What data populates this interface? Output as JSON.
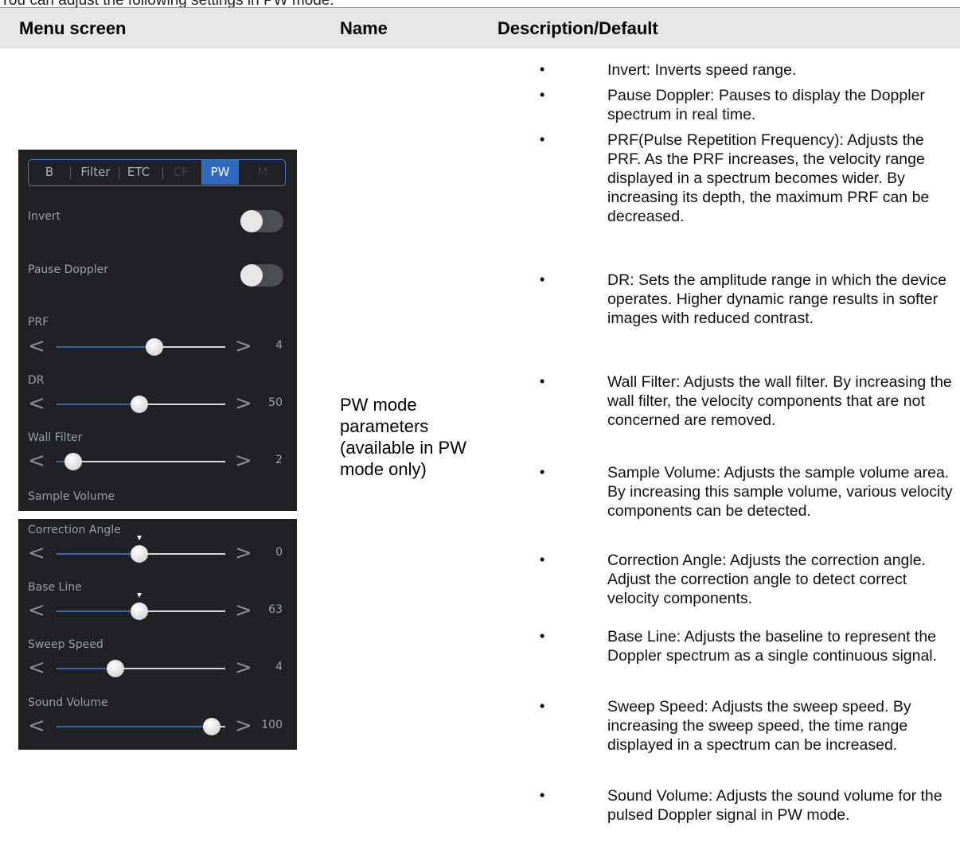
{
  "intro_text": "You can adjust the following settings in PW mode:",
  "table": {
    "headers": [
      "Menu screen",
      "Name",
      "Description/Default"
    ],
    "name": "PW mode parameters (available in PW mode only)"
  },
  "descriptions": [
    "Invert: Inverts speed range.",
    "Pause Doppler: Pauses to display the Doppler spectrum in real time.",
    "PRF(Pulse Repetition Frequency): Adjusts the PRF. As the PRF increases, the velocity range displayed in a spectrum becomes wider. By increasing its depth, the maximum PRF can be decreased.",
    "DR: Sets the amplitude range in which the device operates. Higher dynamic range results in softer images with reduced contrast.",
    "Wall Filter: Adjusts the wall filter. By increasing the wall filter, the velocity components that are not concerned are removed.",
    "Sample Volume: Adjusts the sample volume area. By increasing this sample volume, various velocity components can be detected.",
    "Correction Angle: Adjusts the correction angle. Adjust the correction angle to detect correct velocity components.",
    "Base Line: Adjusts the baseline to represent the Doppler spectrum as a single continuous signal.",
    "Sweep Speed: Adjusts the sweep speed. By increasing the sweep speed, the time range displayed in a spectrum can be increased.",
    "Sound Volume: Adjusts the sound volume for the pulsed Doppler signal in PW mode."
  ],
  "bullet": "•",
  "menu": {
    "tabs": [
      "B",
      "Filter",
      "ETC",
      "CF",
      "PW",
      "M"
    ],
    "active_tab": "PW",
    "chevron_left": "<",
    "chevron_right": ">",
    "invert_label": "Invert",
    "invert_on": false,
    "pause_label": "Pause Doppler",
    "pause_on": false,
    "prf": {
      "label": "PRF",
      "value": "4",
      "position": 0.58
    },
    "dr": {
      "label": "DR",
      "value": "50",
      "position": 0.49
    },
    "wall_filter": {
      "label": "Wall Filter",
      "value": "2",
      "position": 0.1
    },
    "sample_volume_label": "Sample Volume",
    "correction_angle": {
      "label": "Correction Angle",
      "value": "0",
      "position": 0.49
    },
    "base_line": {
      "label": "Base Line",
      "value": "63",
      "position": 0.49
    },
    "sweep_speed": {
      "label": "Sweep Speed",
      "value": "4",
      "position": 0.35
    },
    "sound_volume": {
      "label": "Sound Volume",
      "value": "100",
      "position": 0.92
    },
    "colors": {
      "panel": "#1f2124",
      "accent": "#2f6bc4",
      "track_fill": "#3a64a8"
    }
  }
}
